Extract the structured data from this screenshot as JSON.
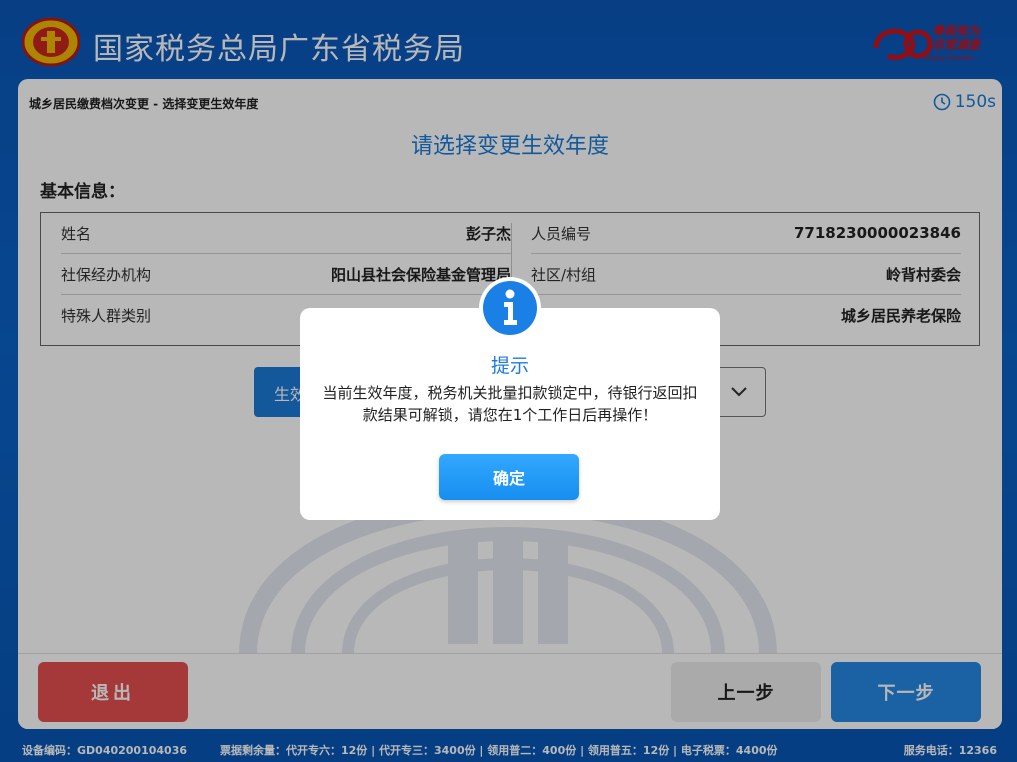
{
  "header": {
    "title": "国家税务总局广东省税务局",
    "slogan_line1": "粤税有为",
    "slogan_line2": "非常满意",
    "slogan_sub": "Highly Satisfied"
  },
  "page": {
    "breadcrumb": "城乡居民缴费档次变更 - 选择变更生效年度",
    "timer": "150s",
    "title": "请选择变更生效年度",
    "section_label": "基本信息："
  },
  "info": {
    "left": [
      {
        "label": "姓名",
        "value": "彭子杰"
      },
      {
        "label": "社保经办机构",
        "value": "阳山县社会保险基金管理局"
      },
      {
        "label": "特殊人群类别",
        "value": ""
      }
    ],
    "right": [
      {
        "label": "人员编号",
        "value": "7718230000023846"
      },
      {
        "label": "社区/村组",
        "value": "岭背村委会"
      },
      {
        "label": "",
        "value": "城乡居民养老保险"
      }
    ]
  },
  "year_selector": {
    "label": "生效",
    "value": ""
  },
  "buttons": {
    "exit": "退出",
    "prev": "上一步",
    "next": "下一步"
  },
  "status_bar": {
    "device_code": "设备编码：GD040200104036",
    "tickets": "票据剩余量：代开专六：12份 | 代开专三：3400份 | 领用普二：400份 | 领用普五：12份 | 电子税票：4400份",
    "service_phone": "服务电话：12366"
  },
  "dialog": {
    "title": "提示",
    "message": "当前生效年度，税务机关批量扣款锁定中，待银行返回扣款结果可解锁，请您在1个工作日后再操作！",
    "ok_label": "确定"
  },
  "colors": {
    "brand_blue": "#1c7ad8",
    "exit_red": "#e54e4e",
    "header_bg": "#0a57b8"
  }
}
